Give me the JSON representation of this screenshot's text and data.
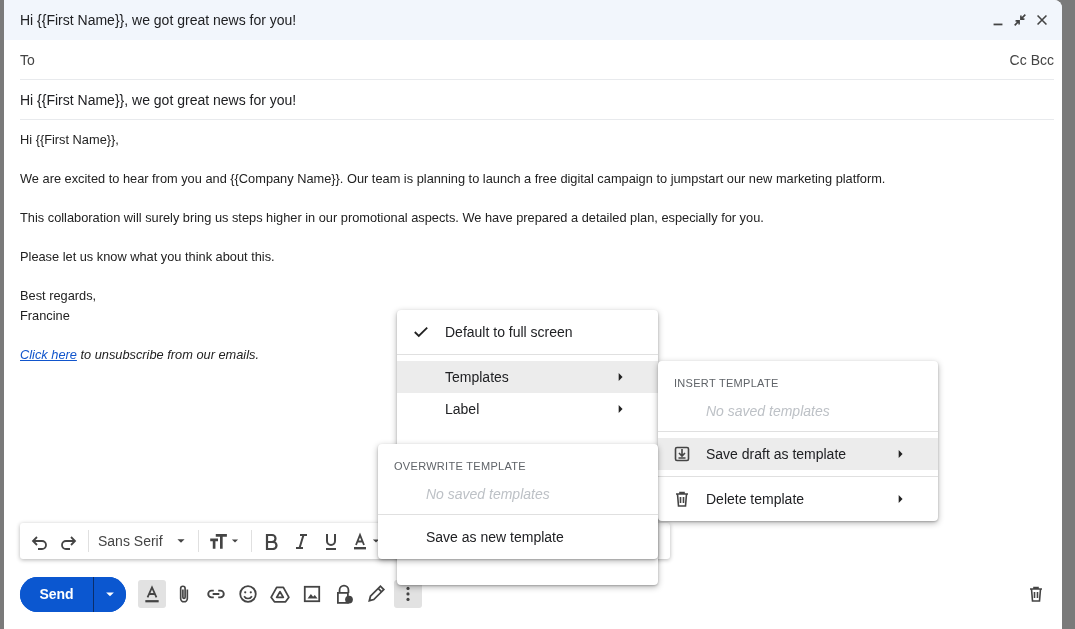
{
  "window": {
    "title": "Hi {{First Name}}, we got great news for you!"
  },
  "recipients": {
    "label": "To",
    "links": [
      "Cc",
      "Bcc"
    ]
  },
  "subject": "Hi {{First Name}}, we got great news for you!",
  "body": {
    "paragraphs": [
      [
        "Hi {{First Name}},"
      ],
      [
        "We are excited to hear from you and {{Company Name}}. Our team is planning to launch a free digital campaign to jumpstart our new marketing platform."
      ],
      [
        "This collaboration will surely bring us steps higher in our promotional aspects. We have prepared a detailed plan, especially for you."
      ],
      [
        "Please let us know what you think about this."
      ],
      [
        "Best regards,",
        "Francine"
      ]
    ],
    "footer": {
      "link": "Click here",
      "text": "to unsubscribe from our emails."
    }
  },
  "format_toolbar": {
    "font": "Sans Serif"
  },
  "send_button": "Send",
  "bottom_tools": [
    {
      "kind": "formatting",
      "selected": true
    },
    {
      "kind": "attach",
      "selected": false
    },
    {
      "kind": "link",
      "selected": false
    },
    {
      "kind": "emoji",
      "selected": false
    },
    {
      "kind": "drive",
      "selected": false
    },
    {
      "kind": "photo",
      "selected": false
    },
    {
      "kind": "confidential",
      "selected": false
    },
    {
      "kind": "signature",
      "selected": false
    },
    {
      "kind": "more",
      "selected": true
    }
  ],
  "more_menu": {
    "sections": [
      [
        {
          "label": "Default to full screen",
          "checked": true,
          "selected": false,
          "submenu": false
        }
      ],
      [
        {
          "label": "Templates",
          "checked": false,
          "selected": true,
          "submenu": true
        },
        {
          "label": "Label",
          "checked": false,
          "selected": false,
          "submenu": true
        }
      ]
    ]
  },
  "templates_menu": {
    "header": "INSERT TEMPLATE",
    "empty": "No saved templates",
    "items": [
      {
        "label": "Save draft as template",
        "kind": "save",
        "selected": true,
        "submenu": true
      },
      {
        "label": "Delete template",
        "kind": "delete",
        "selected": false,
        "submenu": true
      }
    ]
  },
  "overwrite_menu": {
    "header": "OVERWRITE TEMPLATE",
    "empty": "No saved templates",
    "items": [
      {
        "label": "Save as new template",
        "selected": false
      }
    ]
  }
}
